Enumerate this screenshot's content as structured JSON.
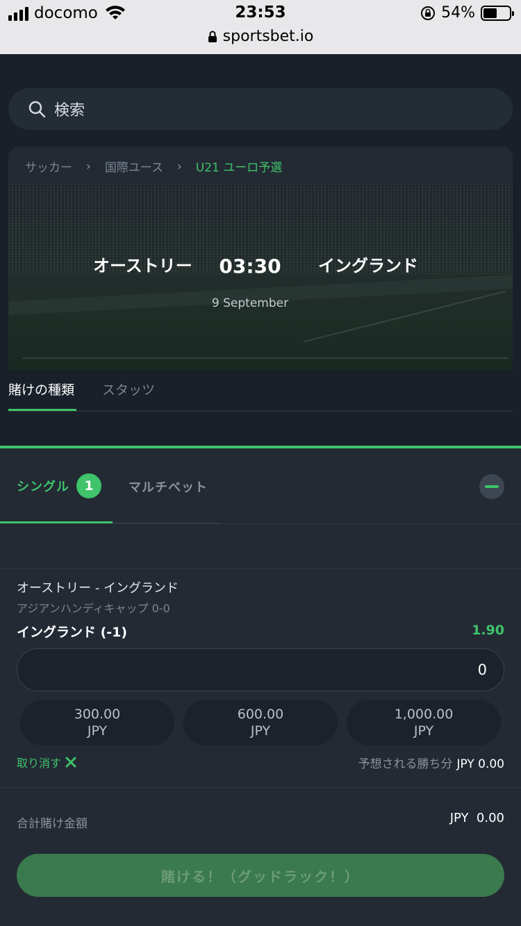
{
  "status_bar": {
    "carrier": "docomo",
    "time": "23:53",
    "battery_percent": "54%",
    "battery_level": 0.54,
    "url": "sportsbet.io"
  },
  "search": {
    "placeholder": "検索"
  },
  "breadcrumb": [
    "サッカー",
    "国際ユース",
    "U21 ユーロ予選"
  ],
  "match": {
    "home": "オーストリー",
    "away": "イングランド",
    "time": "03:30",
    "date": "9 September"
  },
  "tabs": [
    "賭けの種類",
    "スタッツ"
  ],
  "bet_slip": {
    "tab_single": "シングル",
    "single_count": "1",
    "tab_multi": "マルチベット",
    "selection": {
      "match": "オーストリー - イングランド",
      "market": "アジアンハンディキャップ 0-0",
      "pick": "イングランド (-1)",
      "odds": "1.90"
    },
    "stake_value": "0",
    "quick_stakes": [
      {
        "amount": "300.00",
        "currency": "JPY"
      },
      {
        "amount": "600.00",
        "currency": "JPY"
      },
      {
        "amount": "1,000.00",
        "currency": "JPY"
      }
    ],
    "cancel_label": "取り消す",
    "potential_win_label": "予想される勝ち分",
    "potential_win_amount": "JPY 0.00",
    "total_label": "合計賭け金額",
    "total_amount": "JPY  0.00",
    "place_bet_label": "賭ける！（グッドラック！）"
  },
  "colors": {
    "accent": "#3fc36b",
    "background": "#1c222b",
    "panel": "#232a34"
  }
}
